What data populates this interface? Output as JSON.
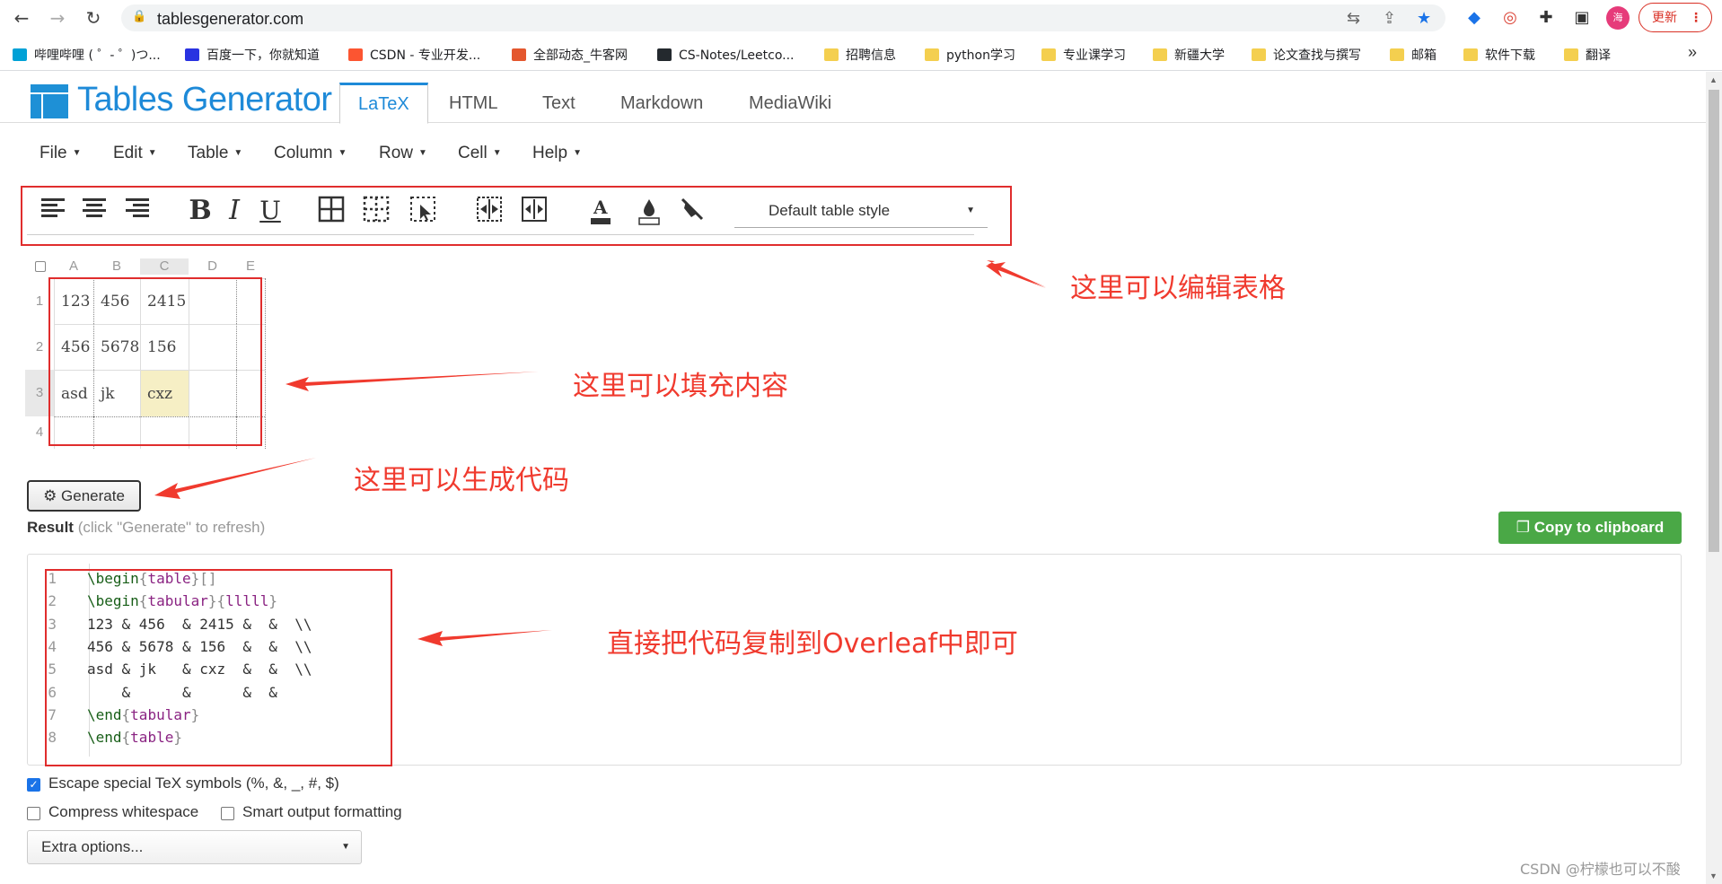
{
  "browser": {
    "url": "tablesgenerator.com",
    "update_label": "更新",
    "avatar_text": "海",
    "bookmarks": [
      {
        "label": "哔哩哔哩 ( ゜- ゜)つ...",
        "color": "#00a1d6"
      },
      {
        "label": "百度一下，你就知道",
        "color": "#2932e1"
      },
      {
        "label": "CSDN - 专业开发...",
        "color": "#fc5531"
      },
      {
        "label": "全部动态_牛客网",
        "color": "#e4572e"
      },
      {
        "label": "CS-Notes/Leetco...",
        "color": "#24292e"
      },
      {
        "label": "招聘信息",
        "color": "#f4cf4f"
      },
      {
        "label": "python学习",
        "color": "#f4cf4f"
      },
      {
        "label": "专业课学习",
        "color": "#f4cf4f"
      },
      {
        "label": "新疆大学",
        "color": "#f4cf4f"
      },
      {
        "label": "论文查找与撰写",
        "color": "#f4cf4f"
      },
      {
        "label": "邮箱",
        "color": "#f4cf4f"
      },
      {
        "label": "软件下载",
        "color": "#f4cf4f"
      },
      {
        "label": "翻译",
        "color": "#f4cf4f"
      }
    ]
  },
  "site": {
    "logo_text": "Tables Generator",
    "tabs": [
      "LaTeX",
      "HTML",
      "Text",
      "Markdown",
      "MediaWiki"
    ],
    "active_tab": "LaTeX",
    "menu": [
      "File",
      "Edit",
      "Table",
      "Column",
      "Row",
      "Cell",
      "Help"
    ],
    "table_style": "Default table style"
  },
  "grid": {
    "columns": [
      "A",
      "B",
      "C",
      "D",
      "E"
    ],
    "rows": [
      "1",
      "2",
      "3",
      "4"
    ],
    "cells": [
      [
        "123",
        "456",
        "2415",
        "",
        ""
      ],
      [
        "456",
        "5678",
        "156",
        "",
        ""
      ],
      [
        "asd",
        "jk",
        "cxz",
        "",
        ""
      ],
      [
        "",
        "",
        "",
        "",
        ""
      ]
    ],
    "selected_cell": "C3"
  },
  "generate_label": "Generate",
  "result": {
    "label": "Result",
    "hint": "(click \"Generate\" to refresh)",
    "copy_label": "Copy to clipboard",
    "code": [
      "\\begin{table}[]",
      "\\begin{tabular}{lllll}",
      "123 & 456  & 2415 &  &  \\\\",
      "456 & 5678 & 156  &  &  \\\\",
      "asd & jk   & cxz  &  &  \\\\",
      "    &      &      &  &",
      "\\end{tabular}",
      "\\end{table}"
    ]
  },
  "options": {
    "escape": "Escape special TeX symbols (%, &, _, #, $)",
    "compress": "Compress whitespace",
    "smart": "Smart output formatting",
    "extra": "Extra options..."
  },
  "annotations": {
    "edit": "这里可以编辑表格",
    "fill": "这里可以填充内容",
    "generate": "这里可以生成代码",
    "copy": "直接把代码复制到Overleaf中即可"
  },
  "watermark": "CSDN @柠檬也可以不酸",
  "colors": {
    "accent": "#1e8ad8",
    "annotation": "#f03a2e",
    "copy_button": "#4aa846",
    "selected_cell": "#f6efc5"
  }
}
